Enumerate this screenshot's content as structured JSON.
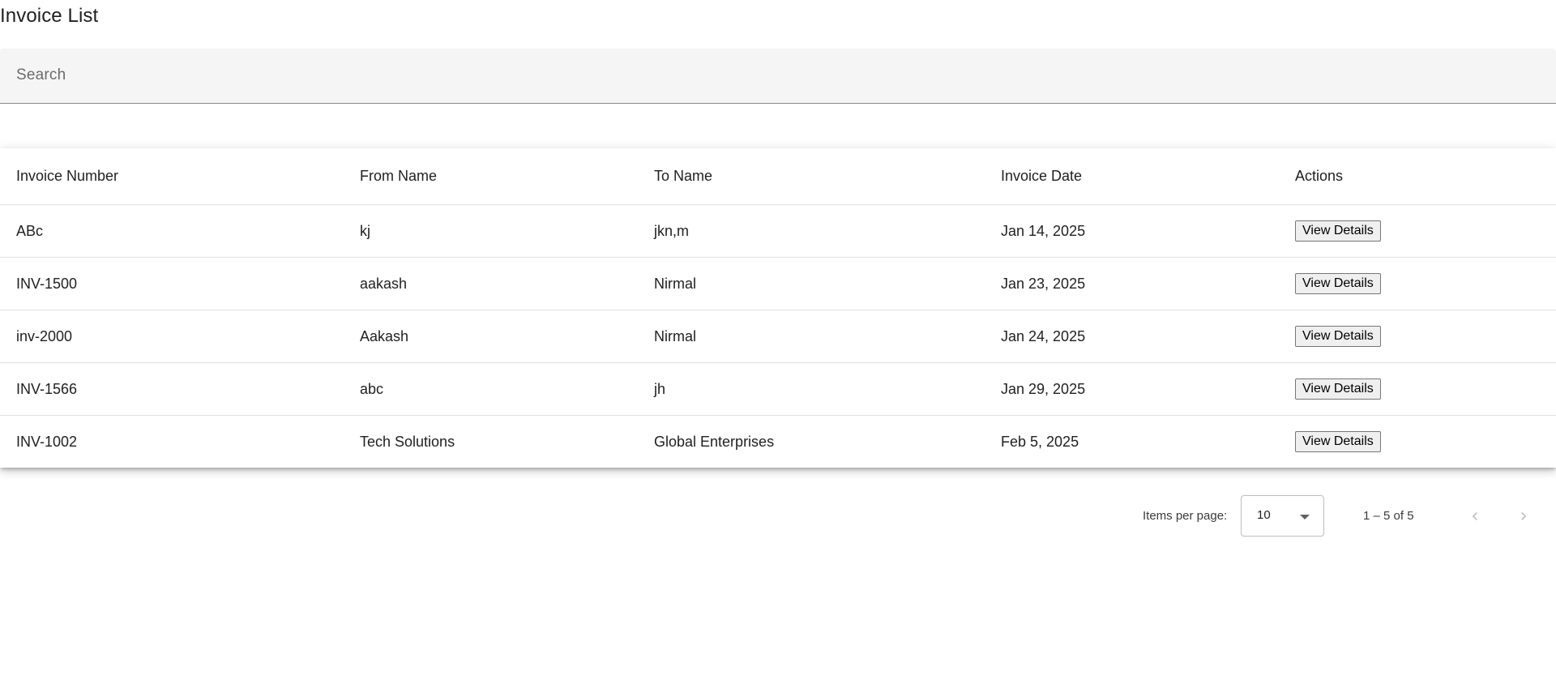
{
  "header": {
    "title": "Invoice List"
  },
  "search": {
    "placeholder": "Search",
    "value": ""
  },
  "table": {
    "columns": [
      "Invoice Number",
      "From Name",
      "To Name",
      "Invoice Date",
      "Actions"
    ],
    "rows": [
      {
        "invoice_number": "ABc",
        "from_name": "kj",
        "to_name": "jkn,m",
        "invoice_date": "Jan 14, 2025",
        "action_label": "View Details"
      },
      {
        "invoice_number": "INV-1500",
        "from_name": "aakash",
        "to_name": "Nirmal",
        "invoice_date": "Jan 23, 2025",
        "action_label": "View Details"
      },
      {
        "invoice_number": "inv-2000",
        "from_name": "Aakash",
        "to_name": "Nirmal",
        "invoice_date": "Jan 24, 2025",
        "action_label": "View Details"
      },
      {
        "invoice_number": "INV-1566",
        "from_name": "abc",
        "to_name": "jh",
        "invoice_date": "Jan 29, 2025",
        "action_label": "View Details"
      },
      {
        "invoice_number": "INV-1002",
        "from_name": "Tech Solutions",
        "to_name": "Global Enterprises",
        "invoice_date": "Feb 5, 2025",
        "action_label": "View Details"
      }
    ]
  },
  "paginator": {
    "items_per_page_label": "Items per page:",
    "page_size": "10",
    "range_label": "1 – 5 of 5",
    "prev_icon": "chevron-left-icon",
    "next_icon": "chevron-right-icon",
    "prev_disabled": true,
    "next_disabled": true
  },
  "colors": {
    "search_background": "#f5f5f5",
    "disabled_icon": "#bdbdbd"
  }
}
